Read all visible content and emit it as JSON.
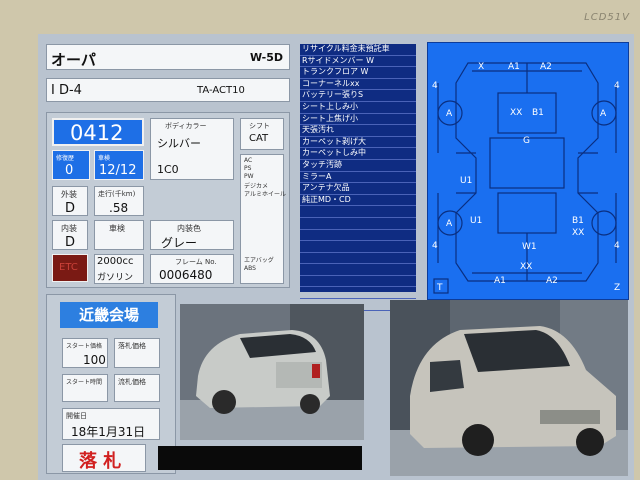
{
  "bezel": {
    "label": "LCD51V"
  },
  "header": {
    "model": "オーパ",
    "code": "W-5D",
    "grade": "I D-4",
    "chassis": "TA-ACT10"
  },
  "lot": {
    "number": "0412",
    "left_small_label": "修復歴",
    "left_small_value": "0",
    "inspection_label": "車検",
    "inspection_value": "12/12"
  },
  "color": {
    "label": "ボディカラー",
    "name": "シルバー",
    "code": "1C0"
  },
  "shift": {
    "label": "シフト",
    "value": "CAT"
  },
  "equipment": [
    "AC",
    "PS",
    "PW",
    "デジカメ",
    "アルミホイール",
    "エアバッグ",
    "ABS"
  ],
  "exterior": {
    "label": "外装",
    "value": "D"
  },
  "mileage": {
    "label": "走行(千km)",
    "value": ".58"
  },
  "interior": {
    "label": "内装",
    "value": "D"
  },
  "vehicle_label": "車検",
  "interior_color": {
    "label": "内装色",
    "value": "グレー"
  },
  "badge": "ETC",
  "engine": {
    "cc": "2000cc",
    "fuel": "ガソリン"
  },
  "frame": {
    "label": "フレーム No.",
    "value": "0006480"
  },
  "notes": [
    "リサイクル料金未預託車",
    "Rサイドメンバー W",
    "トランクフロア W",
    "コーナーネルxx",
    "バッテリー張りS",
    "シート上しみ小",
    "シート上焦げ小",
    "天張汚れ",
    "カーペット剥げ大",
    "カーペットしみ中",
    "タッチ汚跡",
    "ミラーA",
    "アンテナ欠品",
    "純正MD・CD",
    "",
    "",
    "",
    "",
    "",
    "",
    "",
    "",
    ""
  ],
  "diagram": {
    "marks": [
      "X",
      "A1",
      "A2",
      "4",
      "4",
      "A",
      "XX",
      "B1",
      "A",
      "G",
      "U1",
      "U1",
      "A",
      "B1",
      "XX",
      "4",
      "W1",
      "4",
      "XX",
      "A1",
      "A2",
      "T",
      "Z"
    ]
  },
  "auction": {
    "venue": "近畿会場",
    "start_price_label": "スタート価格",
    "start_price": "100",
    "sold_price_label": "落札価格",
    "sold_price": "",
    "start_time_label": "スタート時間",
    "sold_time_label": "流札価格",
    "date_label": "開催日",
    "date": "18年1月31日",
    "result": "落 札"
  },
  "colors": {
    "accent_blue": "#2d7fe0",
    "lot_blue": "#1e6fe6",
    "list_navy": "#0f2c82",
    "diagram_blue": "#1a6ff0"
  }
}
